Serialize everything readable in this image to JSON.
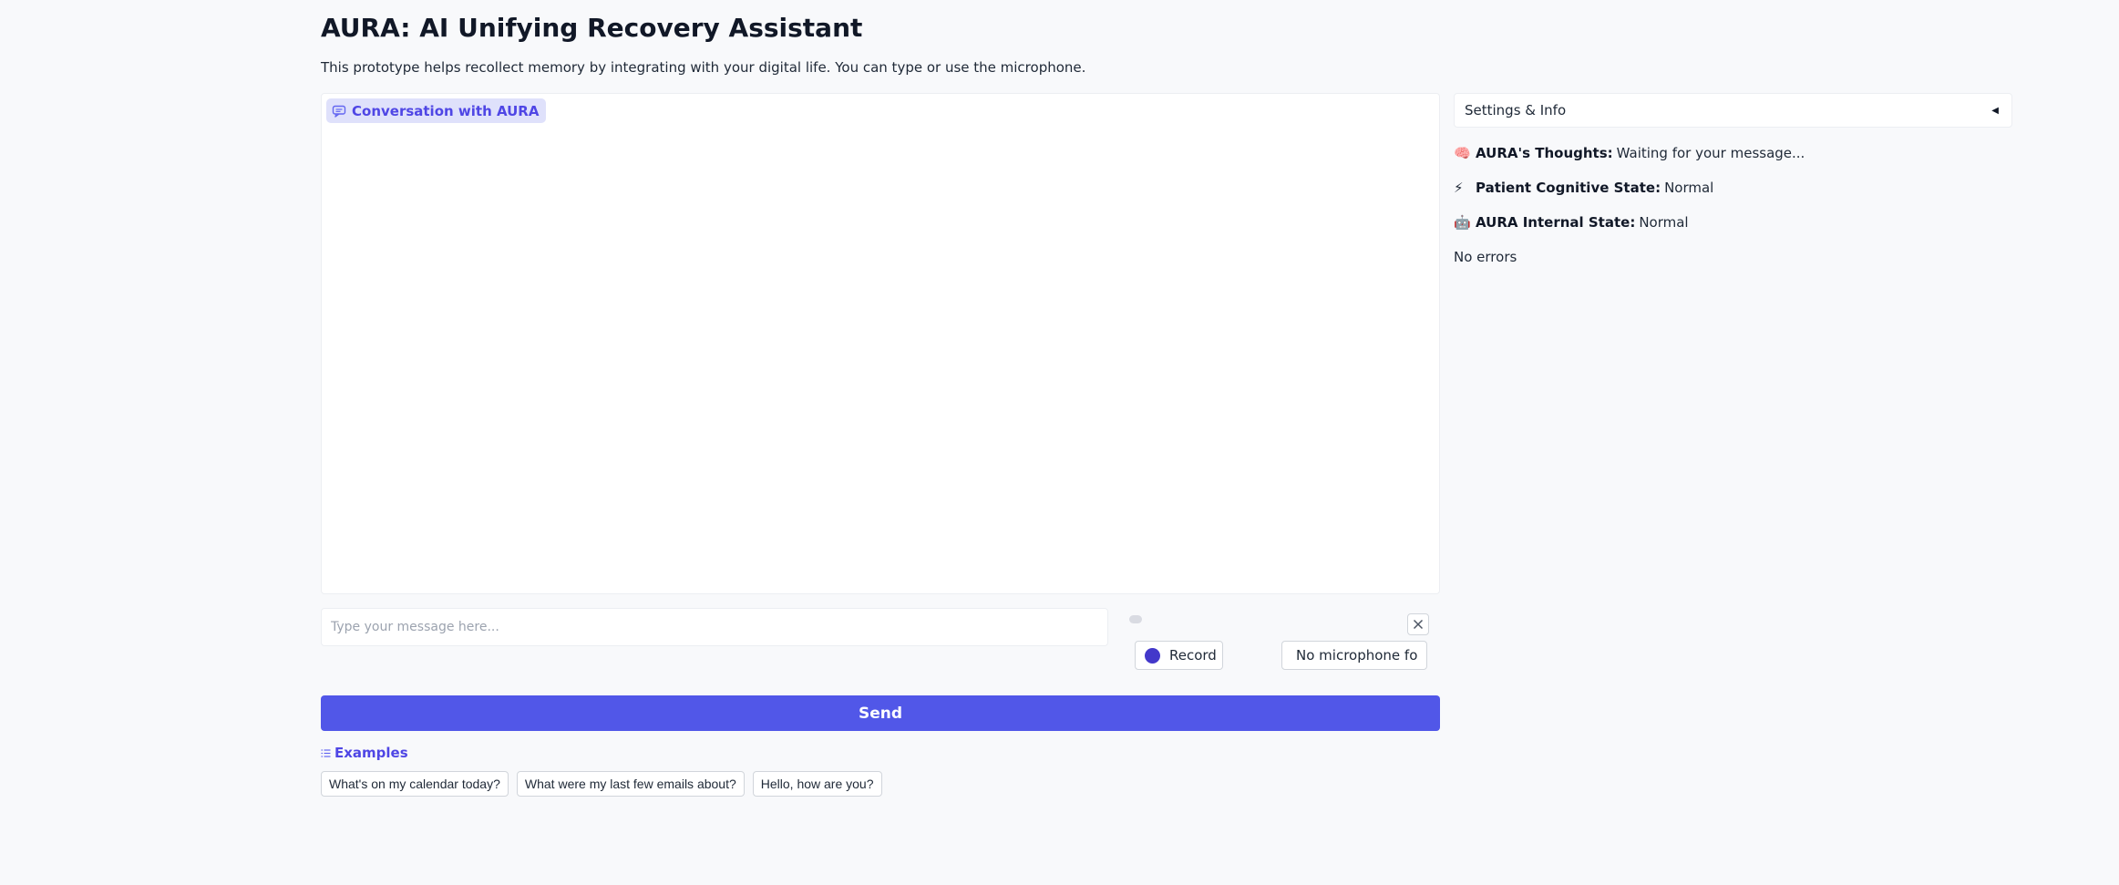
{
  "header": {
    "title": "AURA: AI Unifying Recovery Assistant",
    "subtitle": "This prototype helps recollect memory by integrating with your digital life. You can type or use the microphone."
  },
  "chat": {
    "label": "Conversation with AURA",
    "icon": "chat-bubble-icon"
  },
  "input": {
    "placeholder": "Type your message here...",
    "value": ""
  },
  "audio": {
    "record_label": "Record",
    "microphone_select": "No microphone fo",
    "close_icon": "close-icon"
  },
  "send_label": "Send",
  "examples": {
    "label": "Examples",
    "icon": "list-icon",
    "items": [
      "What's on my calendar today?",
      "What were my last few emails about?",
      "Hello, how are you?"
    ]
  },
  "sidebar": {
    "settings_label": "Settings & Info",
    "caret_icon": "caret-left-icon",
    "thoughts": {
      "icon": "🧠",
      "label": "AURA's Thoughts:",
      "value": "Waiting for your message..."
    },
    "patient_state": {
      "icon": "⚡",
      "label": "Patient Cognitive State:",
      "value": "Normal"
    },
    "internal_state": {
      "icon": "🤖",
      "label": "AURA Internal State:",
      "value": "Normal"
    },
    "errors": "No errors"
  },
  "colors": {
    "accent": "#5157e8",
    "label_bg": "#dfe1fb",
    "label_text": "#4f46e5",
    "record_dot": "#4338ca"
  }
}
